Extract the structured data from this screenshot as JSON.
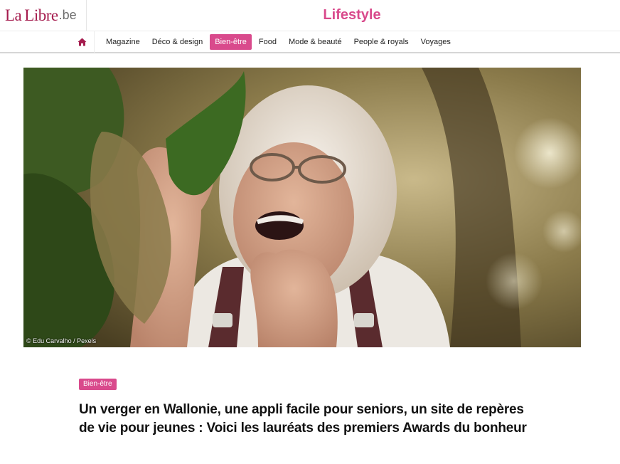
{
  "header": {
    "logo": {
      "part1": "La",
      "part2": "Libre",
      "part3": ".be"
    },
    "section_title": "Lifestyle"
  },
  "nav": {
    "home_icon": "home-icon",
    "items": [
      {
        "label": "Magazine"
      },
      {
        "label": "Déco & design"
      },
      {
        "label": "Bien-être",
        "active": true
      },
      {
        "label": "Food"
      },
      {
        "label": "Mode & beauté"
      },
      {
        "label": "People & royals"
      },
      {
        "label": "Voyages"
      }
    ],
    "active_color": "#d94a8c"
  },
  "hero": {
    "credit": "© Edu Carvalho / Pexels"
  },
  "article": {
    "tag": "Bien-être",
    "headline": "Un verger en Wallonie, une appli facile pour seniors, un site de repères de vie pour jeunes : Voici les lauréats des premiers Awards du bonheur"
  },
  "colors": {
    "brand": "#a51c4e",
    "accent": "#d94a8c"
  }
}
